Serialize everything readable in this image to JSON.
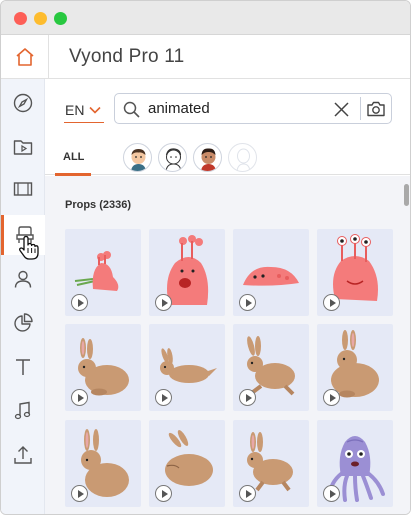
{
  "window": {
    "title_bar_buttons": [
      "close",
      "minimize",
      "maximize"
    ]
  },
  "app": {
    "title": "Vyond Pro 11",
    "accent": "#e3652f"
  },
  "sidebar": {
    "items": [
      {
        "icon": "compass-icon"
      },
      {
        "icon": "folder-video-icon"
      },
      {
        "icon": "film-icon"
      },
      {
        "icon": "props-chair-icon",
        "active": true
      },
      {
        "icon": "person-icon"
      },
      {
        "icon": "pie-chart-icon"
      },
      {
        "icon": "text-icon"
      },
      {
        "icon": "music-note-icon"
      },
      {
        "icon": "upload-icon"
      }
    ]
  },
  "language": {
    "selected": "EN"
  },
  "search": {
    "value": "animated",
    "placeholder": ""
  },
  "filters": {
    "all_label": "ALL",
    "avatars": [
      "style-business-friendly",
      "style-whiteboard",
      "style-contemporary",
      "style-blank"
    ]
  },
  "section": {
    "title": "Props (2336)"
  },
  "items": [
    {
      "name": "pink-creature-1"
    },
    {
      "name": "pink-creature-2"
    },
    {
      "name": "pink-creature-3"
    },
    {
      "name": "pink-creature-4"
    },
    {
      "name": "rabbit-1"
    },
    {
      "name": "rabbit-2"
    },
    {
      "name": "rabbit-3"
    },
    {
      "name": "rabbit-4"
    },
    {
      "name": "rabbit-5"
    },
    {
      "name": "rabbit-6"
    },
    {
      "name": "rabbit-7"
    },
    {
      "name": "octopus-creature"
    }
  ]
}
